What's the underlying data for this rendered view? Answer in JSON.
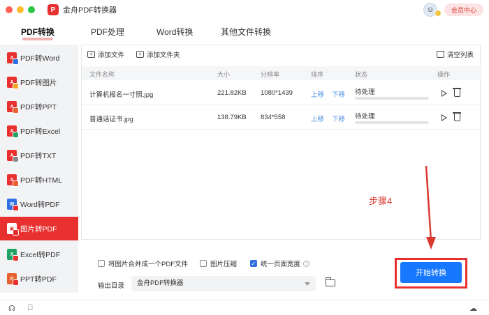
{
  "app": {
    "title": "金舟PDF转换器",
    "logo_text": "P",
    "member_label": "会员中心"
  },
  "main_tabs": [
    {
      "label": "PDF转换",
      "active": true
    },
    {
      "label": "PDF处理",
      "active": false
    },
    {
      "label": "Word转换",
      "active": false
    },
    {
      "label": "其他文件转换",
      "active": false
    }
  ],
  "sidebar": {
    "items": [
      {
        "label": "PDF转Word",
        "icon": "pdf-to-word-icon",
        "badge_color": "#2f6fe4",
        "active": false
      },
      {
        "label": "PDF转图片",
        "icon": "pdf-to-image-icon",
        "badge_color": "#f5a623",
        "active": false
      },
      {
        "label": "PDF转PPT",
        "icon": "pdf-to-ppt-icon",
        "badge_color": "#e8602f",
        "active": false
      },
      {
        "label": "PDF转Excel",
        "icon": "pdf-to-excel-icon",
        "badge_color": "#21a366",
        "active": false
      },
      {
        "label": "PDF转TXT",
        "icon": "pdf-to-txt-icon",
        "badge_color": "#888888",
        "active": false
      },
      {
        "label": "PDF转HTML",
        "icon": "pdf-to-html-icon",
        "badge_color": "#e8602f",
        "active": false
      },
      {
        "label": "Word转PDF",
        "icon": "word-to-pdf-icon",
        "badge_color": "#e8312f",
        "active": false
      },
      {
        "label": "图片转PDF",
        "icon": "image-to-pdf-icon",
        "badge_color": "#e8312f",
        "active": true
      },
      {
        "label": "Excel转PDF",
        "icon": "excel-to-pdf-icon",
        "badge_color": "#e8312f",
        "active": false
      },
      {
        "label": "PPT转PDF",
        "icon": "ppt-to-pdf-icon",
        "badge_color": "#e8312f",
        "active": false
      }
    ]
  },
  "toolbar": {
    "add_file": "添加文件",
    "add_folder": "添加文件夹",
    "clear_list": "清空列表"
  },
  "table": {
    "headers": {
      "name": "文件名称",
      "size": "大小",
      "resolution": "分辨率",
      "order": "排序",
      "status": "状态",
      "action": "操作"
    },
    "rows": [
      {
        "name": "计算机报名一寸照.jpg",
        "size": "221.82KB",
        "resolution": "1080*1439",
        "up": "上移",
        "down": "下移",
        "status": "待处理",
        "progress": 0
      },
      {
        "name": "普通话证书.jpg",
        "size": "138.79KB",
        "resolution": "834*558",
        "up": "上移",
        "down": "下移",
        "status": "待处理",
        "progress": 0
      }
    ]
  },
  "options": {
    "merge": {
      "label": "将图片合并成一个PDF文件",
      "checked": false
    },
    "compress": {
      "label": "图片压缩",
      "checked": false
    },
    "unify_width": {
      "label": "统一页面宽度",
      "checked": true
    }
  },
  "output": {
    "label": "输出目录",
    "value": "金舟PDF转换器"
  },
  "start_button": "开始转换",
  "annotation": {
    "step_label": "步骤4",
    "color": "#d9382f"
  }
}
